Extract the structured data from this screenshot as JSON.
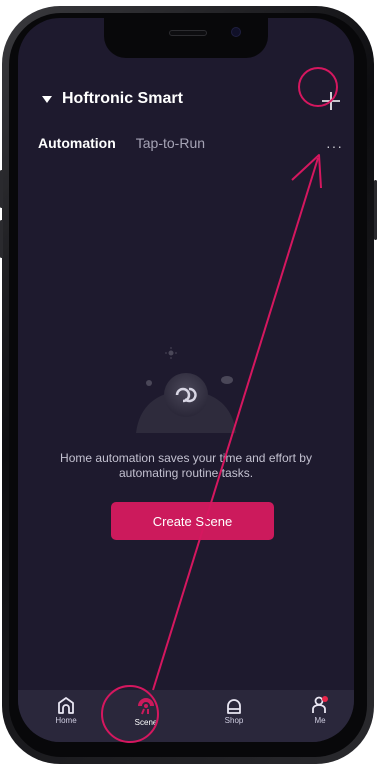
{
  "header": {
    "home_name": "Hoftronic Smart"
  },
  "tabs": [
    {
      "label": "Automation",
      "active": true
    },
    {
      "label": "Tap-to-Run",
      "active": false
    }
  ],
  "more_label": "···",
  "empty_state": {
    "message": "Home automation saves your time and effort by automating routine tasks.",
    "button_label": "Create Scene"
  },
  "bottom_nav": [
    {
      "label": "Home",
      "icon": "home-icon",
      "active": false
    },
    {
      "label": "Scene",
      "icon": "scene-icon",
      "active": true
    },
    {
      "label": "Shop",
      "icon": "shop-icon",
      "active": false
    },
    {
      "label": "Me",
      "icon": "me-icon",
      "active": false
    }
  ],
  "colors": {
    "background": "#1e1a2e",
    "accent": "#cc1a5c",
    "annotation": "#d5175f",
    "nav_background": "#2a273b"
  }
}
